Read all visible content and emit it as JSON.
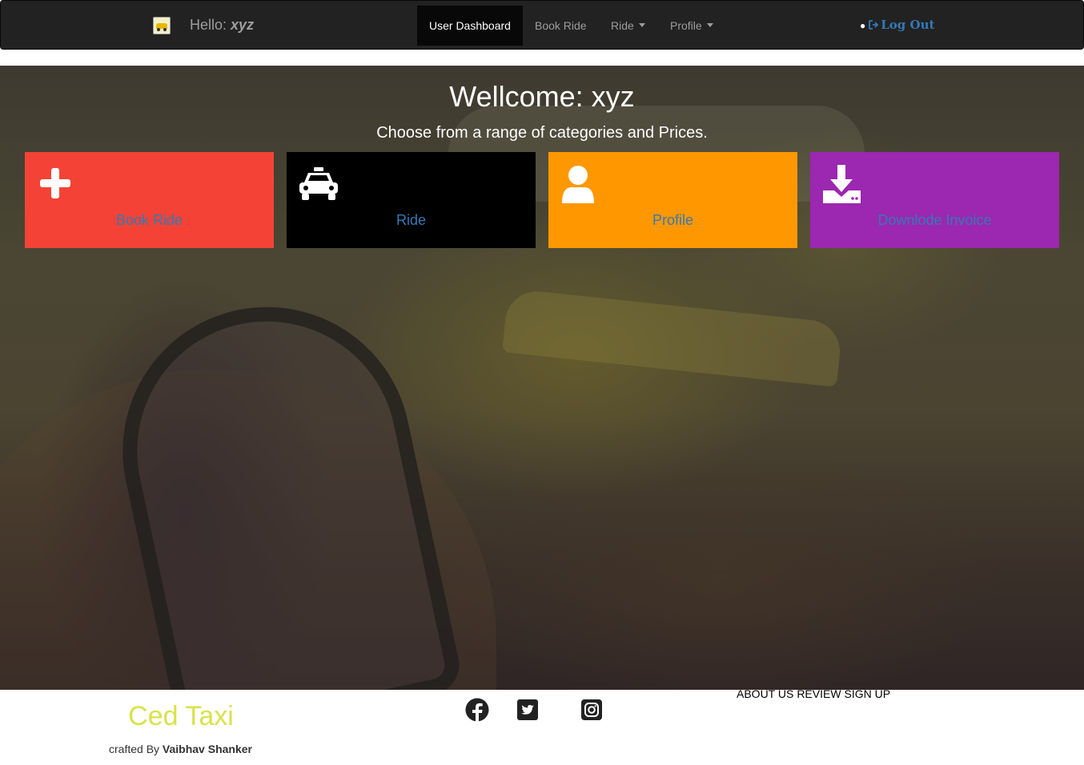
{
  "navbar": {
    "greeting_prefix": "Hello:",
    "username": "xyz",
    "logo_icon": "taxi-logo-icon",
    "items": [
      {
        "label": "User Dashboard",
        "active": true
      },
      {
        "label": "Book Ride"
      },
      {
        "label": "Ride"
      },
      {
        "label": "Profile"
      }
    ],
    "logout_label": "Log Out",
    "logout_icon": "sign-out-icon"
  },
  "hero": {
    "title": "Wellcome: xyz",
    "subtitle": "Choose from a range of categories and Prices.",
    "cards": [
      {
        "label": "Book Ride",
        "icon": "plus-icon",
        "color": "#f44336"
      },
      {
        "label": "Ride",
        "icon": "taxi-icon",
        "color": "#000000"
      },
      {
        "label": "Profile",
        "icon": "user-icon",
        "color": "#ff9800"
      },
      {
        "label": "Downlode Invoice",
        "icon": "download-icon",
        "color": "#9c27b0"
      }
    ]
  },
  "footer": {
    "brand": "Ced Taxi",
    "credit_prefix": "crafted By",
    "credit_name": "Vaibhav Shanker",
    "social": [
      "facebook-icon",
      "twitter-icon",
      "instagram-icon"
    ],
    "links": [
      "ABOUT US",
      "REVIEW",
      "SIGN UP"
    ]
  },
  "colors": {
    "navbar_bg": "#222222",
    "link_blue": "#337ab7",
    "brand_yellow": "#d9e24a"
  }
}
